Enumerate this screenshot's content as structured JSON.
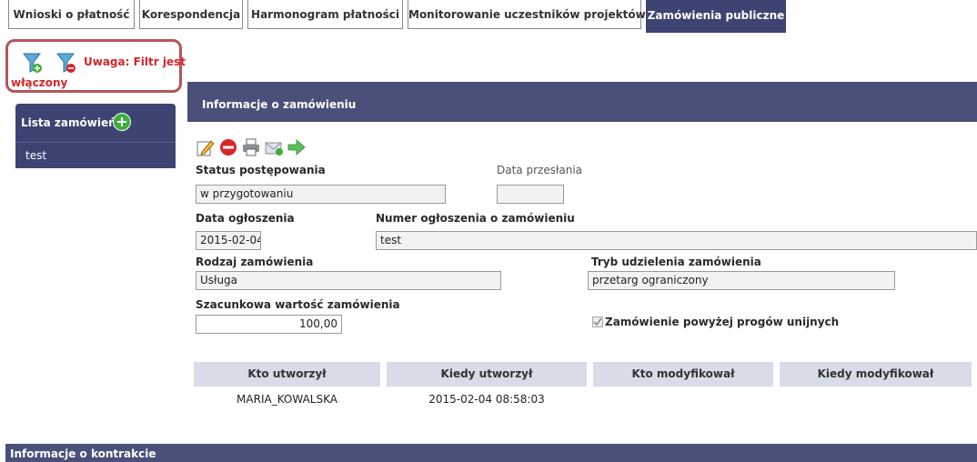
{
  "tabs": [
    {
      "label": "Wnioski o płatność",
      "active": false
    },
    {
      "label": "Korespondencja",
      "active": false
    },
    {
      "label": "Harmonogram płatności",
      "active": false
    },
    {
      "label": "Monitorowanie uczestników projektów",
      "active": false
    },
    {
      "label": "Zamówienia publiczne",
      "active": true
    }
  ],
  "filter": {
    "warning_line1": "Uwaga: Filtr jest",
    "warning_line2": "włączony",
    "icons": [
      "filter-add-icon",
      "filter-remove-icon"
    ]
  },
  "sidebar": {
    "title": "Lista zamówień",
    "add_icon": "plus-circle-icon",
    "items": [
      {
        "label": "test"
      }
    ]
  },
  "order_info": {
    "title": "Informacje o zamówieniu",
    "toolbar_icons": [
      "edit-icon",
      "delete-icon",
      "print-icon",
      "send-mail-icon",
      "forward-arrow-icon"
    ],
    "status_label": "Status postępowania",
    "status_value": "w przygotowaniu",
    "sent_date_label": "Data przesłania",
    "sent_date_value": "",
    "announce_date_label": "Data ogłoszenia",
    "announce_date_value": "2015-02-04",
    "announce_number_label": "Numer ogłoszenia o zamówieniu",
    "announce_number_value": "test",
    "order_type_label": "Rodzaj zamówienia",
    "order_type_value": "Usługa",
    "mode_label": "Tryb udzielenia zamówienia",
    "mode_value": "przetarg ograniczony",
    "estimated_value_label": "Szacunkowa wartość zamówienia",
    "estimated_value": "100,00",
    "above_eu_label": "Zamówienie powyżej progów unijnych",
    "above_eu_checked": true
  },
  "audit": {
    "headers": [
      "Kto utworzył",
      "Kiedy utworzył",
      "Kto modyfikował",
      "Kiedy modyfikował"
    ],
    "row": [
      "MARIA_KOWALSKA",
      "2015-02-04 08:58:03",
      "",
      ""
    ]
  },
  "contract_info": {
    "title": "Informacje o kontrakcie"
  },
  "colors": {
    "accent": "#3d4472",
    "filter_border": "#b5565a",
    "warning_text": "#d6262a"
  }
}
